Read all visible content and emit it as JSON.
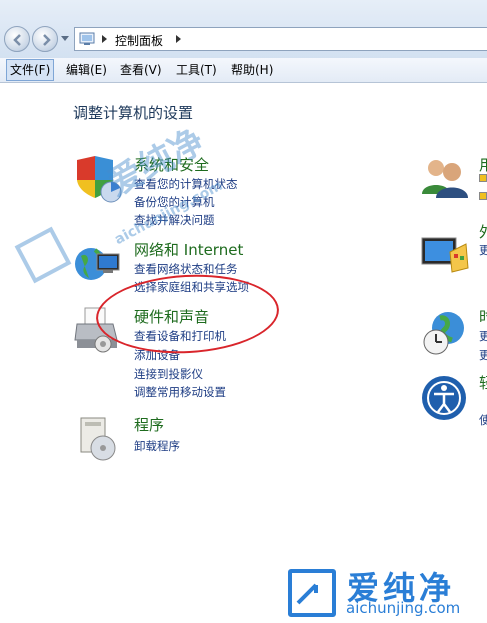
{
  "address": {
    "crumbs": [
      "控制面板"
    ]
  },
  "menu": [
    "文件(F)",
    "编辑(E)",
    "查看(V)",
    "工具(T)",
    "帮助(H)"
  ],
  "page": {
    "heading": "调整计算机的设置"
  },
  "categories": [
    {
      "title": "系统和安全",
      "links": [
        "查看您的计算机状态",
        "备份您的计算机",
        "查找并解决问题"
      ]
    },
    {
      "title": "网络和 Internet",
      "links": [
        "查看网络状态和任务",
        "选择家庭组和共享选项"
      ]
    },
    {
      "title": "硬件和声音",
      "links": [
        "查看设备和打印机",
        "添加设备",
        "连接到投影仪",
        "调整常用移动设置"
      ]
    },
    {
      "title": "程序",
      "links": [
        "卸载程序"
      ]
    }
  ],
  "right_column": {
    "titles": [
      "用",
      "外",
      "时",
      "轻"
    ],
    "links": [
      "更",
      "更",
      "更",
      "使"
    ]
  },
  "watermark": {
    "text": "爱纯净",
    "url": "aichunjing.com"
  },
  "colors": {
    "highlight_circle": "#d9252b",
    "category_title": "#1e6b1e",
    "link": "#1e3d84",
    "brand": "#2a7ed6"
  }
}
